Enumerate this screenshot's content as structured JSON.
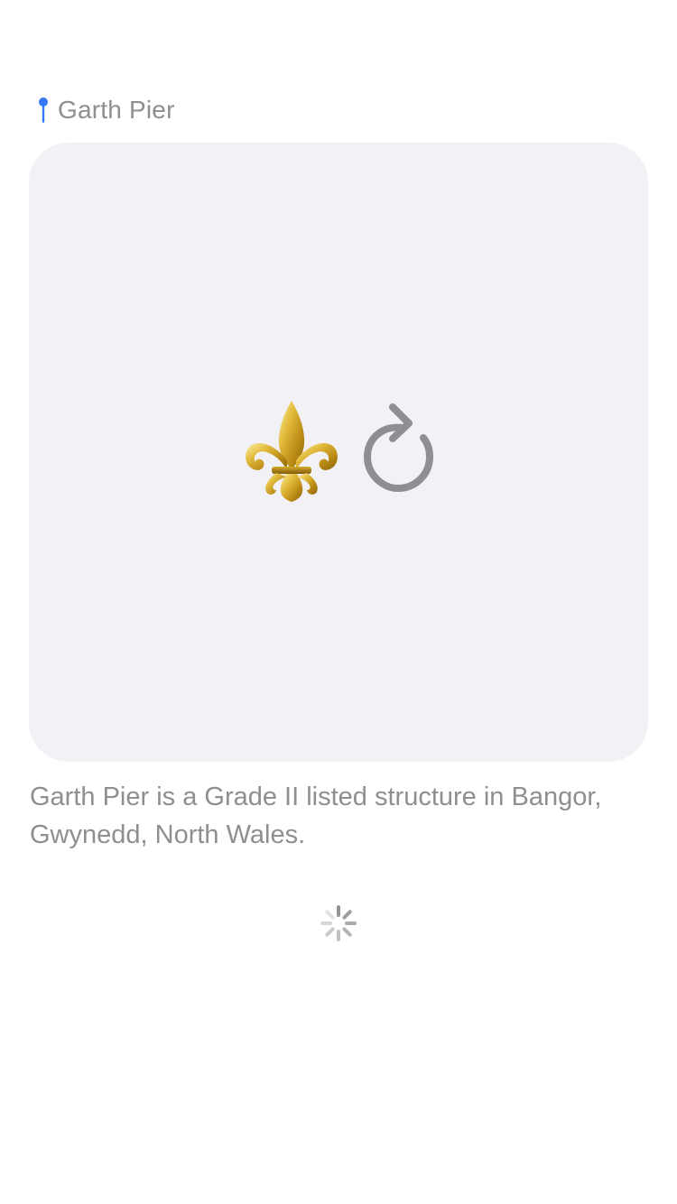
{
  "location": {
    "name": "Garth Pier",
    "icon": "map-pin-icon",
    "icon_color": "#3478f6"
  },
  "media": {
    "background_color": "#f2f1f6",
    "emoji": "⚜️",
    "emoji_icon": "fleur-de-lis-icon",
    "retry_icon": "retry-arrow-icon",
    "retry_color": "#8e8e93"
  },
  "description": {
    "text": "Garth Pier is a Grade II listed structure in Bangor, Gwynedd, North Wales."
  },
  "loading": {
    "icon": "activity-spinner-icon"
  }
}
